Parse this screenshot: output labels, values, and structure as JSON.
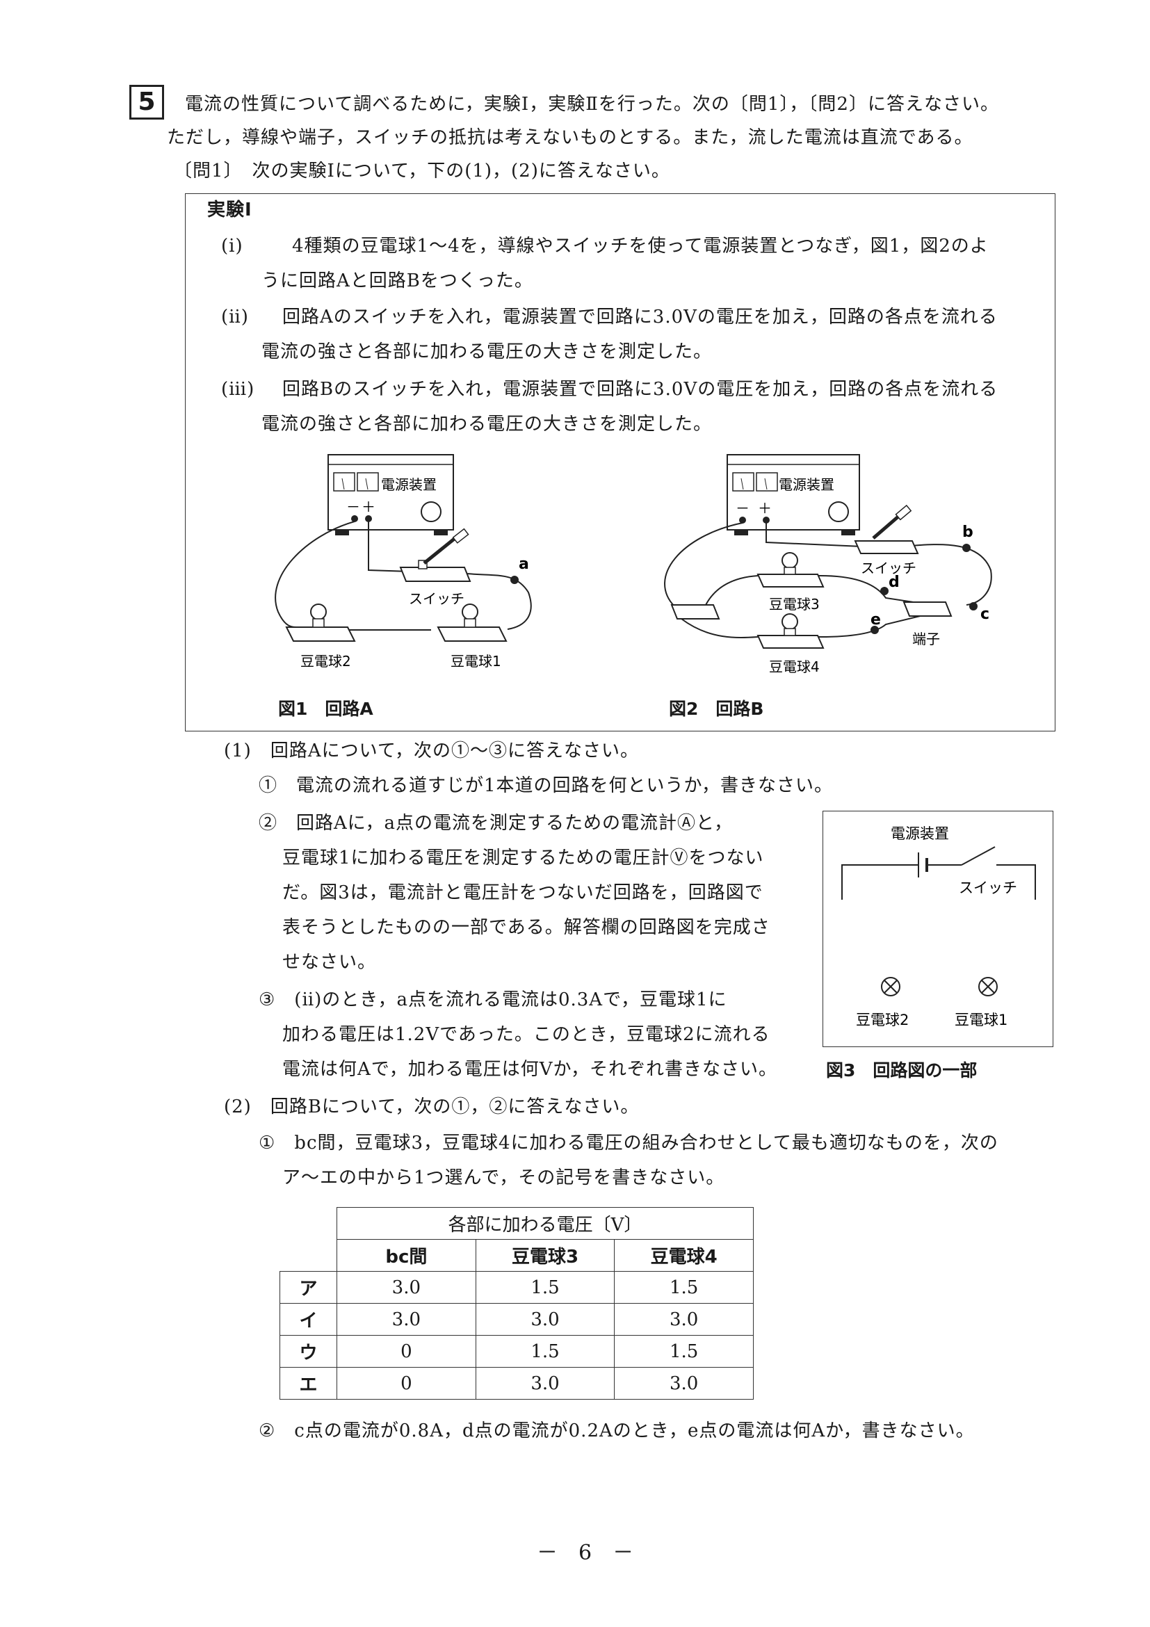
{
  "header": {
    "number": "5",
    "intro_line1": "電流の性質について調べるために，実験Ⅰ，実験Ⅱを行った。次の〔問1〕，〔問2〕に答えなさい。",
    "intro_line2": "ただし，導線や端子，スイッチの抵抗は考えないものとする。また，流した電流は直流である。"
  },
  "q1": {
    "heading": "〔問1〕　次の実験Ⅰについて，下の(1)，(2)に答えなさい。"
  },
  "experiment": {
    "title": "実験Ⅰ",
    "steps": [
      {
        "label": "(ⅰ)",
        "line1": "4種類の豆電球1～4を，導線やスイッチを使って電源装置とつなぎ，図1，図2のよ",
        "line2": "うに回路Aと回路Bをつくった。"
      },
      {
        "label": "(ⅱ)",
        "line1": "回路Aのスイッチを入れ，電源装置で回路に3.0Vの電圧を加え，回路の各点を流れる",
        "line2": "電流の強さと各部に加わる電圧の大きさを測定した。"
      },
      {
        "label": "(ⅲ)",
        "line1": "回路Bのスイッチを入れ，電源装置で回路に3.0Vの電圧を加え，回路の各点を流れる",
        "line2": "電流の強さと各部に加わる電圧の大きさを測定した。"
      }
    ],
    "fig1": {
      "power_label": "電源装置",
      "minus": "－",
      "plus": "＋",
      "switch_label": "スイッチ",
      "point_a": "a",
      "bulb2": "豆電球2",
      "bulb1": "豆電球1",
      "caption": "図1　回路A"
    },
    "fig2": {
      "power_label": "電源装置",
      "minus": "－",
      "plus": "＋",
      "switch_label": "スイッチ",
      "point_b": "b",
      "point_c": "c",
      "point_d": "d",
      "point_e": "e",
      "bulb3": "豆電球3",
      "bulb4": "豆電球4",
      "terminal": "端子",
      "caption": "図2　回路B"
    }
  },
  "part1": {
    "heading": "(1)　回路Aについて，次の①～③に答えなさい。",
    "q1": "①　電流の流れる道すじが1本道の回路を何というか，書きなさい。",
    "q2_lines": [
      "②　回路Aに，a点の電流を測定するための電流計Ⓐと，",
      "豆電球1に加わる電圧を測定するための電圧計Ⓥをつない",
      "だ。図3は，電流計と電圧計をつないだ回路を，回路図で",
      "表そうとしたものの一部である。解答欄の回路図を完成さ",
      "せなさい。"
    ],
    "q3_lines": [
      "③　(ⅱ)のとき，a点を流れる電流は0.3Aで，豆電球1に",
      "加わる電圧は1.2Vであった。このとき，豆電球2に流れる",
      "電流は何Aで，加わる電圧は何Vか，それぞれ書きなさい。"
    ],
    "fig3": {
      "power_label": "電源装置",
      "switch_label": "スイッチ",
      "bulb2": "豆電球2",
      "bulb1": "豆電球1",
      "caption": "図3　回路図の一部"
    }
  },
  "part2": {
    "heading": "(2)　回路Bについて，次の①，②に答えなさい。",
    "q1_line1": "①　bc間，豆電球3，豆電球4に加わる電圧の組み合わせとして最も適切なものを，次の",
    "q1_line2": "ア～エの中から1つ選んで，その記号を書きなさい。",
    "table": {
      "title": "各部に加わる電圧〔V〕",
      "columns": [
        "bc間",
        "豆電球3",
        "豆電球4"
      ],
      "rows": [
        {
          "label": "ア",
          "values": [
            "3.0",
            "1.5",
            "1.5"
          ]
        },
        {
          "label": "イ",
          "values": [
            "3.0",
            "3.0",
            "3.0"
          ]
        },
        {
          "label": "ウ",
          "values": [
            "0",
            "1.5",
            "1.5"
          ]
        },
        {
          "label": "エ",
          "values": [
            "0",
            "3.0",
            "3.0"
          ]
        }
      ]
    },
    "q2": "②　c点の電流が0.8A，d点の電流が0.2Aのとき，e点の電流は何Aか，書きなさい。"
  },
  "footer": {
    "page": "－　6　－"
  }
}
